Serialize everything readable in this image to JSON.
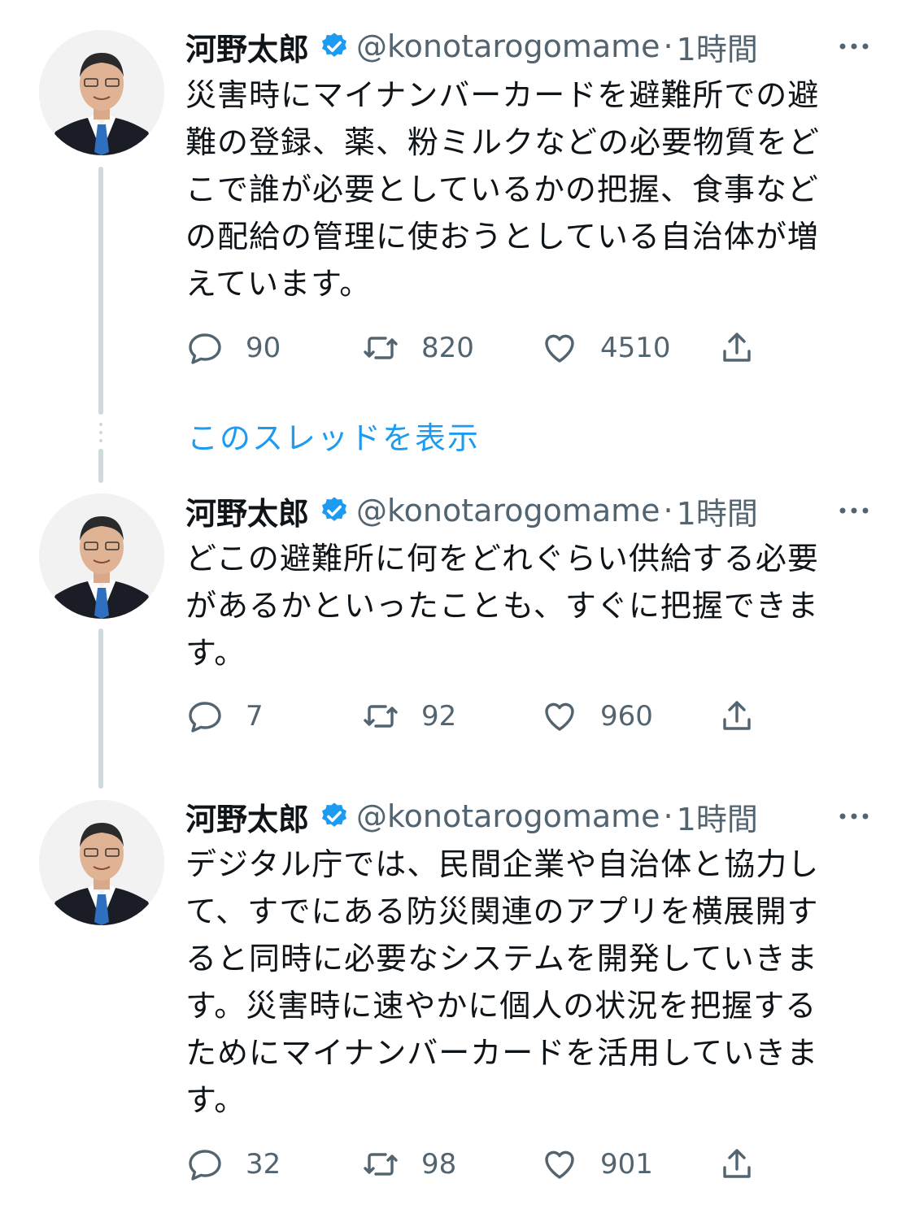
{
  "show_thread_label": "このスレッドを表示",
  "colors": {
    "accent": "#1d9bf0",
    "secondary_text": "#536471",
    "thread_line": "#cfd9de"
  },
  "tweets": [
    {
      "name": "河野太郎",
      "handle": "@konotarogomame",
      "separator": "·",
      "time": "1時間",
      "text": "災害時にマイナンバーカードを避難所での避\n難の登録、薬、粉ミルクなどの必要物質をど\nこで誰が必要としているかの把握、食事など\nの配給の管理に使おうとしている自治体が増\nえています。",
      "replies": "90",
      "retweets": "820",
      "likes": "4510"
    },
    {
      "name": "河野太郎",
      "handle": "@konotarogomame",
      "separator": "·",
      "time": "1時間",
      "text": "どこの避難所に何をどれぐらい供給する必要\nがあるかといったことも、すぐに把握できま\nす。",
      "replies": "7",
      "retweets": "92",
      "likes": "960"
    },
    {
      "name": "河野太郎",
      "handle": "@konotarogomame",
      "separator": "·",
      "time": "1時間",
      "text": "デジタル庁では、民間企業や自治体と協力し\nて、すでにある防災関連のアプリを横展開す\nると同時に必要なシステムを開発していきま\nす。災害時に速やかに個人の状況を把握する\nためにマイナンバーカードを活用していきま\nす。",
      "replies": "32",
      "retweets": "98",
      "likes": "901"
    }
  ]
}
